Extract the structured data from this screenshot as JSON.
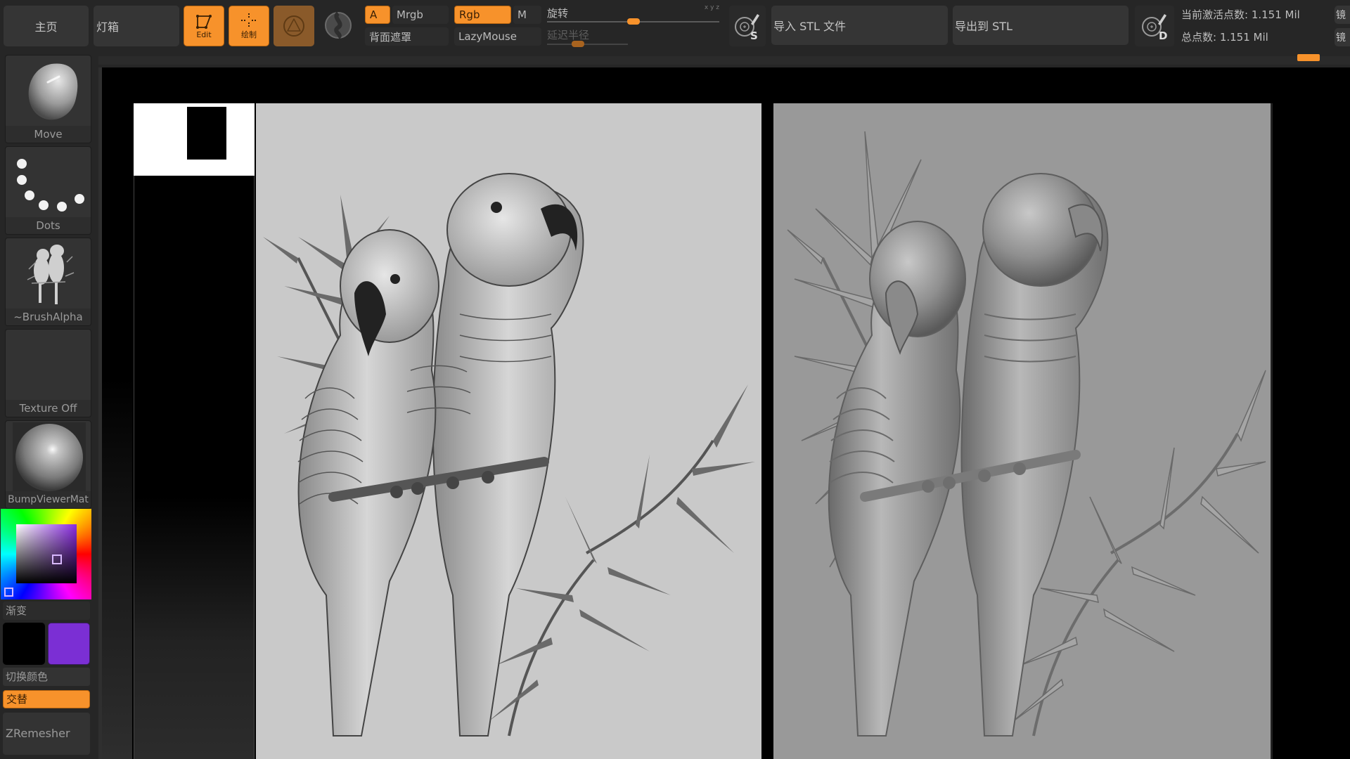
{
  "toolbar": {
    "home_label": "主页",
    "lightbox_label": "灯箱",
    "edit_label": "Edit",
    "draw_label": "绘制",
    "a_label": "A",
    "mrgb_label": "Mrgb",
    "rgb_label": "Rgb",
    "m_label": "M",
    "backface_mask_label": "背面遮罩",
    "lazymouse_label": "LazyMouse",
    "rotate_label": "旋转",
    "rotate_value": 0.5,
    "lazy_radius_label": "延迟半径",
    "lazy_radius_value": 0.3,
    "xyz_label": "x y z",
    "s_badge": "S",
    "d_badge": "D",
    "import_stl_label": "导入 STL 文件",
    "export_stl_label": "导出到 STL",
    "active_points_label": "当前激活点数: 1.151 Mil",
    "total_points_label": "总点数: 1.151 Mil",
    "mirror_label_1": "镜",
    "mirror_label_2": "镜"
  },
  "left_panel": {
    "brush_label": "Move",
    "stroke_label": "Dots",
    "alpha_label": "~BrushAlpha",
    "texture_label": "Texture Off",
    "material_label": "BumpViewerMat",
    "gradient_label": "渐变",
    "switch_color_label": "切换颜色",
    "alternate_label": "交替",
    "zremesher_label": "ZRemesher",
    "primary_color": "#000000",
    "secondary_color": "#7b2fd4"
  },
  "canvas": {
    "left_image_desc": "grayscale drawing of two parrots on a bamboo branch",
    "right_image_desc": "3D relief sculpt of two parrots on a bamboo branch"
  },
  "colors": {
    "accent": "#f7922b",
    "toolbar_bg": "#262626",
    "button_bg": "#353535"
  }
}
